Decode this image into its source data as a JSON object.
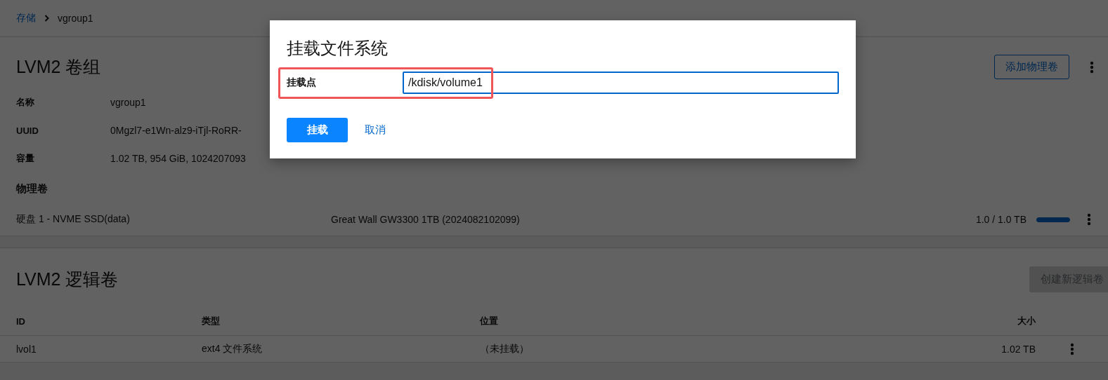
{
  "breadcrumb": [
    {
      "label": "存储",
      "kind": "link"
    },
    {
      "label": "vgroup1",
      "kind": "current"
    }
  ],
  "volume_group": {
    "title": "LVM2 卷组",
    "add_button": "添加物理卷",
    "details": [
      {
        "label": "名称",
        "value": "vgroup1"
      },
      {
        "label": "UUID",
        "value": "0Mgzl7-e1Wn-alz9-iTjl-RoRR-"
      },
      {
        "label": "容量",
        "value": "1.02 TB, 954 GiB, 1024207093"
      }
    ],
    "physical_volumes": {
      "heading": "物理卷",
      "rows": [
        {
          "name": "硬盘 1 - NVME SSD(data)",
          "model": "Great Wall GW3300 1TB (2024082102099)",
          "usage": "1.0 / 1.0 TB",
          "level": 1
        }
      ]
    }
  },
  "logical_volumes": {
    "title": "LVM2 逻辑卷",
    "create_button": {
      "label": "创建新逻辑卷",
      "disabled": true
    },
    "columns": [
      "ID",
      "类型",
      "位置",
      "大小"
    ],
    "rows": [
      {
        "cells": [
          "lvol1",
          "ext4 文件系统",
          "（未挂载）",
          "1.02 TB"
        ]
      }
    ]
  },
  "dialog": {
    "title": "挂载文件系统",
    "field": {
      "label": "挂载点",
      "value": "/kdisk/volume1"
    },
    "buttons": [
      {
        "label": "挂载",
        "kind": "primary"
      },
      {
        "label": "取消",
        "kind": "link"
      }
    ]
  }
}
